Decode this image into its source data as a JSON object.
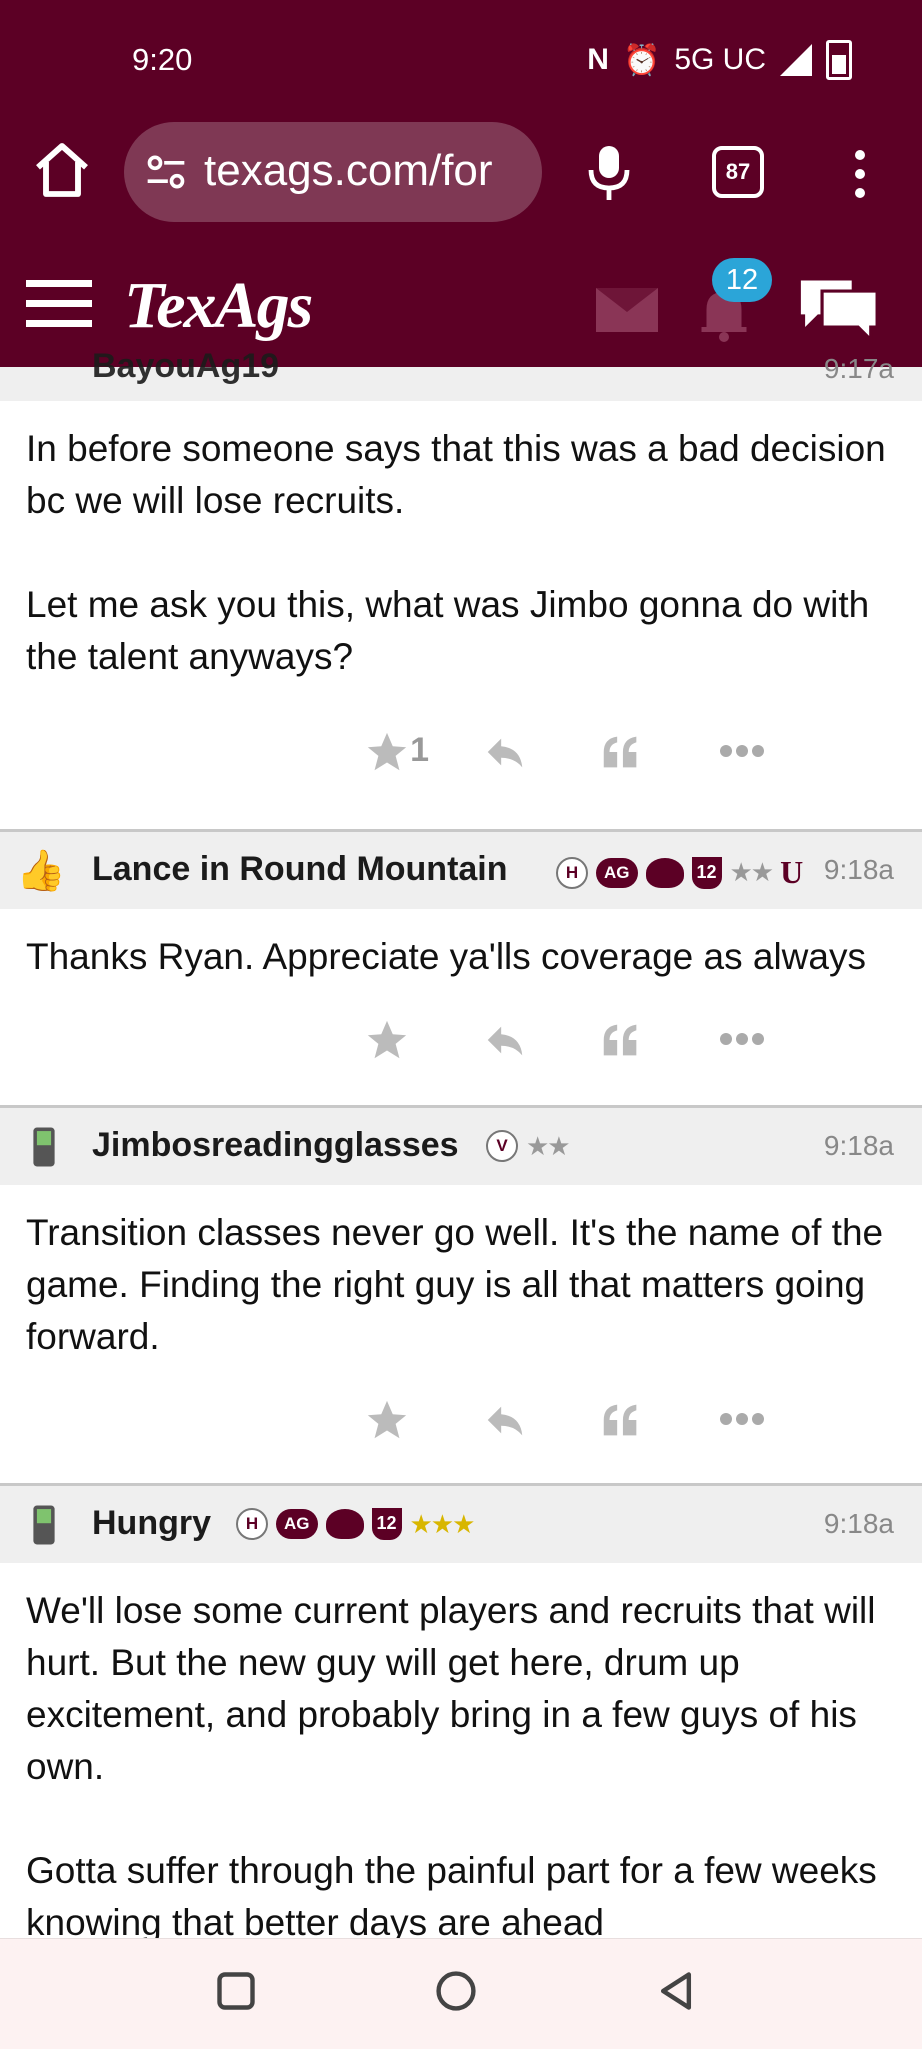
{
  "status_bar": {
    "time": "9:20",
    "network": "5G UC"
  },
  "browser": {
    "url": "texags.com/for",
    "tab_count": "87"
  },
  "site": {
    "logo": "TexAgs",
    "notification_count": "12"
  },
  "posts": [
    {
      "username": "BayouAg19",
      "time": "9:17a",
      "body": "In before someone says that this was a bad decision bc we will lose recruits.\n\nLet me ask you this, what was Jimbo gonna do with the talent anyways?",
      "star_count": "1"
    },
    {
      "username": "Lance in Round Mountain",
      "time": "9:18a",
      "badges": [
        "H",
        "AG",
        "12",
        "★★",
        "U"
      ],
      "body": "Thanks Ryan. Appreciate ya'lls coverage as always"
    },
    {
      "username": "Jimbosreadingglasses",
      "time": "9:18a",
      "badges": [
        "V",
        "★★"
      ],
      "body": "Transition classes never go well. It's the name of the game. Finding the right guy is all that matters going forward."
    },
    {
      "username": "Hungry",
      "time": "9:18a",
      "badges": [
        "H",
        "AG",
        "12",
        "★★★"
      ],
      "body": "We'll lose some current players and recruits that will hurt. But the new guy will get here, drum up excitement, and probably bring in a few guys of his own.\n\nGotta suffer through the painful part for a few weeks knowing that better days are ahead"
    }
  ],
  "colors": {
    "brand": "#5c0025",
    "badge": "#2ba5d8",
    "gold": "#d8b600"
  }
}
